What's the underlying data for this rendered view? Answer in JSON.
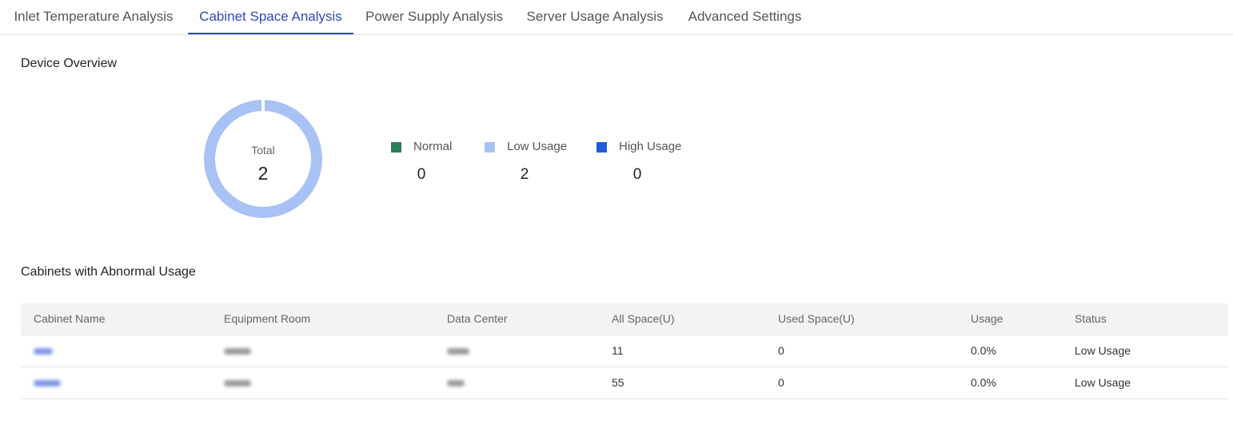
{
  "tabs": [
    {
      "label": "Inlet Temperature Analysis",
      "active": false
    },
    {
      "label": "Cabinet Space Analysis",
      "active": true
    },
    {
      "label": "Power Supply Analysis",
      "active": false
    },
    {
      "label": "Server Usage Analysis",
      "active": false
    },
    {
      "label": "Advanced Settings",
      "active": false
    }
  ],
  "overview": {
    "title": "Device Overview",
    "total_label": "Total",
    "total_value": "2",
    "legend": [
      {
        "label": "Normal",
        "count": "0",
        "color": "#2e7d5b"
      },
      {
        "label": "Low Usage",
        "count": "2",
        "color": "#a9c2f5"
      },
      {
        "label": "High Usage",
        "count": "0",
        "color": "#1f5bdb"
      }
    ]
  },
  "abnormal": {
    "title": "Cabinets with Abnormal Usage",
    "columns": [
      "Cabinet Name",
      "Equipment Room",
      "Data Center",
      "All Space(U)",
      "Used Space(U)",
      "Usage",
      "Status"
    ],
    "rows": [
      {
        "all_space": "11",
        "used_space": "0",
        "usage": "0.0%",
        "status": "Low Usage"
      },
      {
        "all_space": "55",
        "used_space": "0",
        "usage": "0.0%",
        "status": "Low Usage"
      }
    ]
  },
  "colors": {
    "accent": "#2d4ab7",
    "ring": "#a9c2f5"
  }
}
